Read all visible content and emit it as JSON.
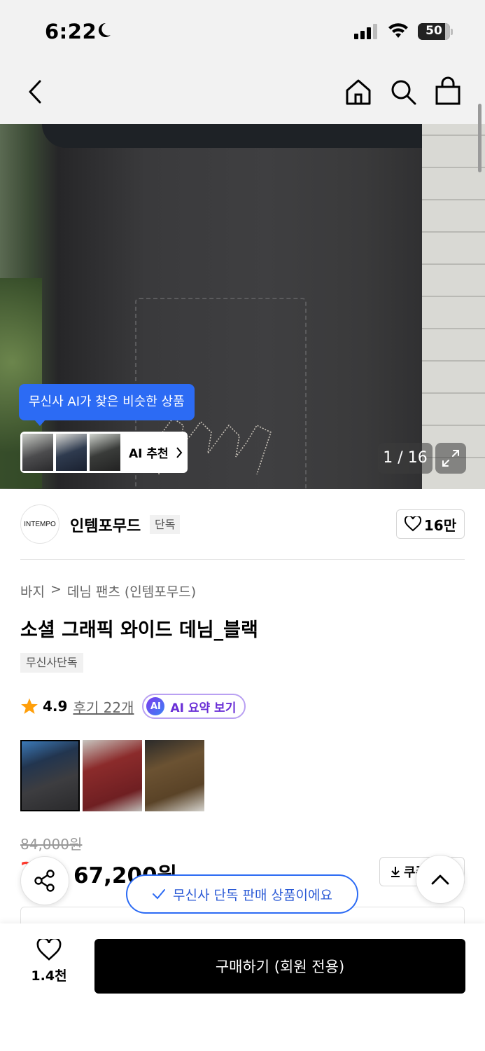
{
  "status_bar": {
    "time": "6:22",
    "battery": "50",
    "battery_percent": 50
  },
  "nav": {
    "back_icon": "chevron-left-icon",
    "home_icon": "home-icon",
    "search_icon": "search-icon",
    "cart_icon": "shopping-bag-icon"
  },
  "gallery": {
    "ai_tooltip": "무신사 AI가 찾은 비슷한 상품",
    "ai_reco_label": "AI 추천",
    "counter": "1 / 16"
  },
  "brand": {
    "logo_text": "INTEMPO",
    "name": "인템포무드",
    "tag": "단독",
    "likes": "16만"
  },
  "breadcrumb": {
    "category": "바지",
    "separator": ">",
    "subcategory": "데님 팬츠 (인템포무드)"
  },
  "product": {
    "title": "소셜 그래픽 와이드 데님_블랙",
    "chip": "무신사단독",
    "rating": "4.9",
    "reviews": "후기 22개",
    "ai_badge": "AI",
    "ai_summary": "AI 요약 보기"
  },
  "pricing": {
    "original": "84,000원",
    "discount": "20%",
    "price": "67,200원",
    "coupon": "쿠폰"
  },
  "toast": {
    "text": "무신사 단독 판매 상품이에요"
  },
  "bottom": {
    "wish_count": "1.4천",
    "buy_label": "구매하기 (회원 전용)"
  },
  "colors": {
    "accent": "#2c6bf4",
    "discount": "#ff3b2f",
    "ai_purple": "#6a2fd6"
  }
}
